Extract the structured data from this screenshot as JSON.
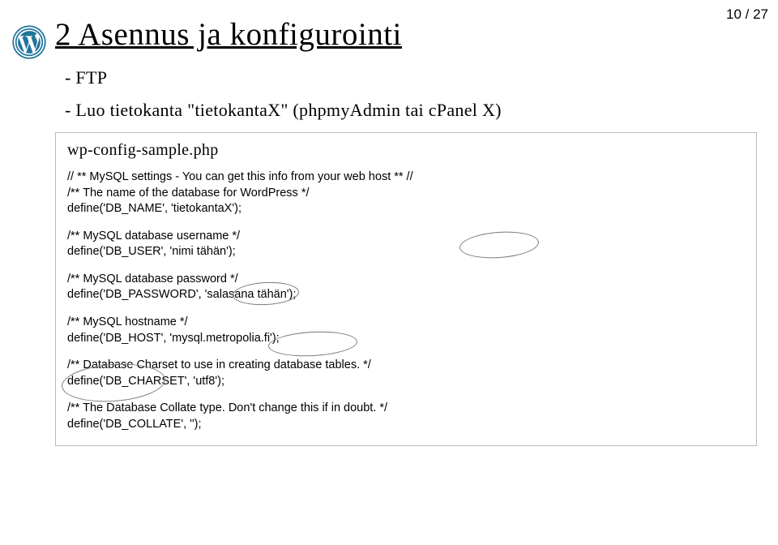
{
  "pageNumber": "10 / 27",
  "title": "2 Asennus ja konfigurointi",
  "bullet1": "- FTP",
  "bullet2": "- Luo tietokanta \"tietokantaX\" (phpmyAdmin tai cPanel X)",
  "filename": "wp-config-sample.php",
  "code": {
    "block1": {
      "line1": "// ** MySQL settings - You can get this info from your web host ** //",
      "line2": "/** The name of the database for WordPress */",
      "line3": "define('DB_NAME', 'tietokantaX');"
    },
    "block2": {
      "line1": "/** MySQL database username */",
      "line2": "define('DB_USER', 'nimi tähän');"
    },
    "block3": {
      "line1": "/** MySQL database password */",
      "line2": "define('DB_PASSWORD', 'salasana tähän');"
    },
    "block4": {
      "line1": "/** MySQL hostname */",
      "line2": "define('DB_HOST', 'mysql.metropolia.fi');"
    },
    "block5": {
      "line1": "/** Database Charset to use in creating database tables. */",
      "line2": "define('DB_CHARSET', 'utf8');"
    },
    "block6": {
      "line1": "/** The Database Collate type. Don't change this if in doubt. */",
      "line2": "define('DB_COLLATE', '');"
    }
  }
}
